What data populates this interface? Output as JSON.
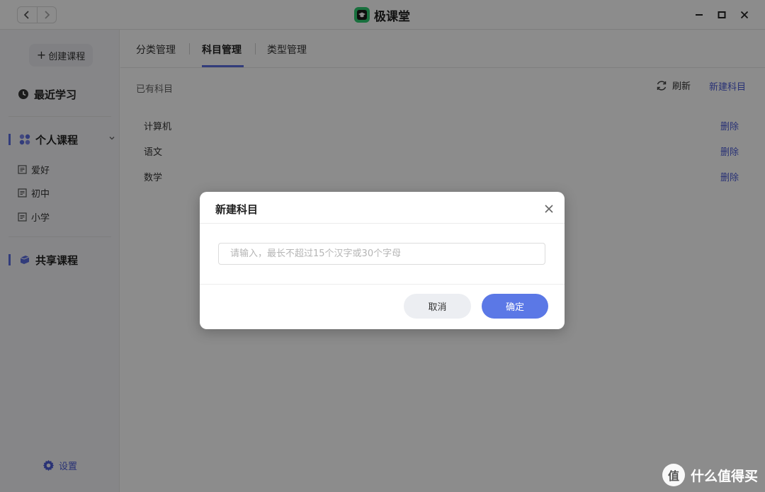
{
  "app": {
    "title": "极课堂",
    "logo_icon": "graduation-cap-icon",
    "brand_color": "#2ecc71",
    "accent_color": "#5b6ee1"
  },
  "sidebar": {
    "create_label": "创建课程",
    "recent": "最近学习",
    "personal": {
      "label": "个人课程",
      "items": [
        {
          "label": "爱好"
        },
        {
          "label": "初中"
        },
        {
          "label": "小学"
        }
      ]
    },
    "shared": "共享课程",
    "settings": "设置"
  },
  "tabs": [
    {
      "label": "分类管理",
      "active": false
    },
    {
      "label": "科目管理",
      "active": true
    },
    {
      "label": "类型管理",
      "active": false
    }
  ],
  "subjects": {
    "section_label": "已有科目",
    "refresh_label": "刷新",
    "new_label": "新建科目",
    "delete_label": "删除",
    "rows": [
      {
        "name": "计算机"
      },
      {
        "name": "语文"
      },
      {
        "name": "数学"
      }
    ]
  },
  "dialog": {
    "title": "新建科目",
    "input_value": "",
    "input_placeholder": "请输入，最长不超过15个汉字或30个字母",
    "cancel_label": "取消",
    "confirm_label": "确定"
  },
  "watermark": {
    "badge": "值",
    "text": "什么值得买"
  }
}
